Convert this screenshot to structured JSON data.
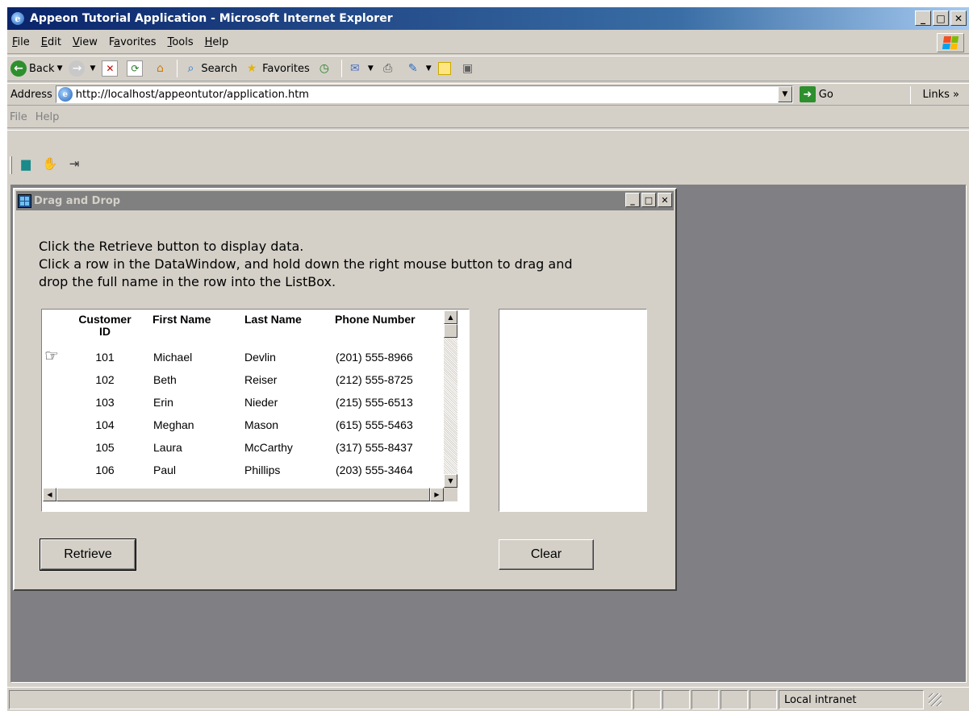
{
  "window": {
    "title": "Appeon Tutorial Application - Microsoft Internet Explorer",
    "controls": {
      "minimize": "_",
      "maximize": "□",
      "close": "✕"
    }
  },
  "menu": [
    {
      "label": "File",
      "accel": "F",
      "rest": "ile"
    },
    {
      "label": "Edit",
      "accel": "E",
      "rest": "dit"
    },
    {
      "label": "View",
      "accel": "V",
      "rest": "iew"
    },
    {
      "label": "Favorites",
      "accel": "a",
      "pre": "F",
      "rest": "vorites"
    },
    {
      "label": "Tools",
      "accel": "T",
      "rest": "ools"
    },
    {
      "label": "Help",
      "accel": "H",
      "rest": "elp"
    }
  ],
  "toolbar": {
    "back": "Back",
    "search": "Search",
    "favorites": "Favorites",
    "icons": [
      "back-icon",
      "forward-icon",
      "stop-icon",
      "refresh-icon",
      "home-icon",
      "search-icon",
      "favorites-icon",
      "history-icon",
      "mail-icon",
      "print-icon",
      "edit-icon",
      "discuss-icon",
      "research-icon"
    ]
  },
  "address": {
    "label": "Address",
    "accel": "d",
    "url": "http://localhost/appeontutor/application.htm",
    "go": "Go",
    "links": "Links"
  },
  "app_menu": {
    "file": "File",
    "help": "Help"
  },
  "app_toolbar": {
    "icons": [
      "database-icon",
      "hand-icon",
      "exit-door-icon"
    ]
  },
  "child_window": {
    "title": "Drag and Drop",
    "instructions": [
      "Click the Retrieve button to display data.",
      "Click a row in the DataWindow, and hold down the right mouse button to drag and",
      "drop the full name in the row into the ListBox."
    ]
  },
  "datawindow": {
    "columns": [
      "Customer\nID",
      "First Name",
      "Last Name",
      "Phone Number"
    ],
    "rows": [
      {
        "id": "101",
        "first": "Michael",
        "last": "Devlin",
        "phone": "(201) 555-8966"
      },
      {
        "id": "102",
        "first": "Beth",
        "last": "Reiser",
        "phone": "(212) 555-8725"
      },
      {
        "id": "103",
        "first": "Erin",
        "last": "Nieder",
        "phone": "(215) 555-6513"
      },
      {
        "id": "104",
        "first": "Meghan",
        "last": "Mason",
        "phone": "(615) 555-5463"
      },
      {
        "id": "105",
        "first": "Laura",
        "last": "McCarthy",
        "phone": "(317) 555-8437"
      },
      {
        "id": "106",
        "first": "Paul",
        "last": "Phillips",
        "phone": "(203) 555-3464"
      }
    ],
    "current_row_pointer": "☞"
  },
  "listbox": {
    "items": []
  },
  "buttons": {
    "retrieve": "Retrieve",
    "clear": "Clear"
  },
  "status": {
    "main": "",
    "zone": "Local intranet"
  }
}
